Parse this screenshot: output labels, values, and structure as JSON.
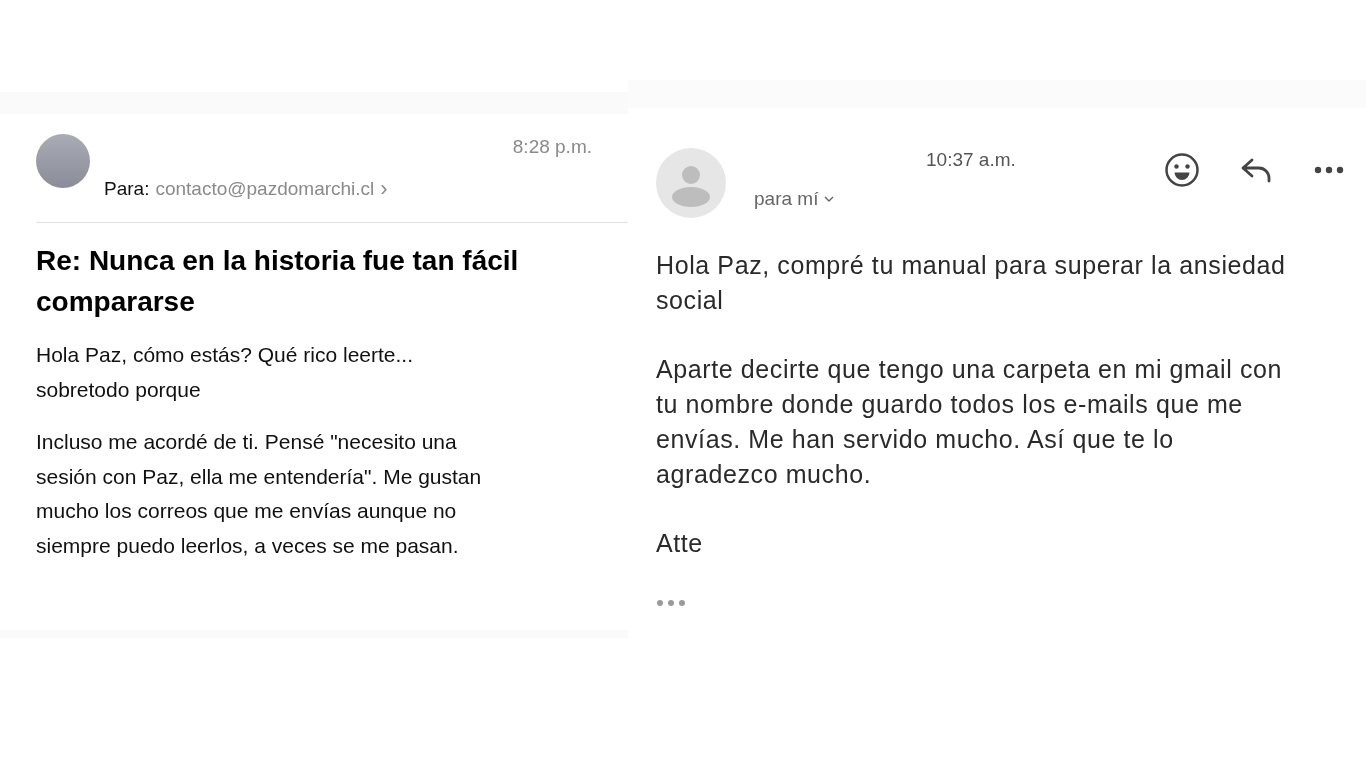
{
  "left_email": {
    "time": "8:28 p.m.",
    "to_label": "Para:",
    "to_address": "contacto@pazdomarchi.cl",
    "to_chevron": "›",
    "subject": "Re: Nunca en la historia fue tan fácil compararse",
    "paragraphs": [
      [
        "Hola Paz, cómo estás? Qué rico leerte...",
        "sobretodo porque"
      ],
      [
        "Incluso me acordé de ti. Pensé \"necesito una",
        "sesión con Paz, ella me entendería\". Me gustan",
        "mucho los correos que me envías aunque no",
        "siempre puedo leerlos, a veces se me pasan."
      ]
    ]
  },
  "right_email": {
    "time": "10:37 a.m.",
    "recipient": "para mí",
    "paragraphs": [
      [
        "Hola Paz, compré tu manual para superar la ansiedad",
        "social"
      ],
      [
        "Aparte decirte que tengo una carpeta en mi gmail con",
        "tu nombre donde guardo todos los e-mails que me",
        "envías. Me han servido mucho. Así que te lo",
        "agradezco mucho."
      ],
      [
        "Atte"
      ]
    ]
  }
}
